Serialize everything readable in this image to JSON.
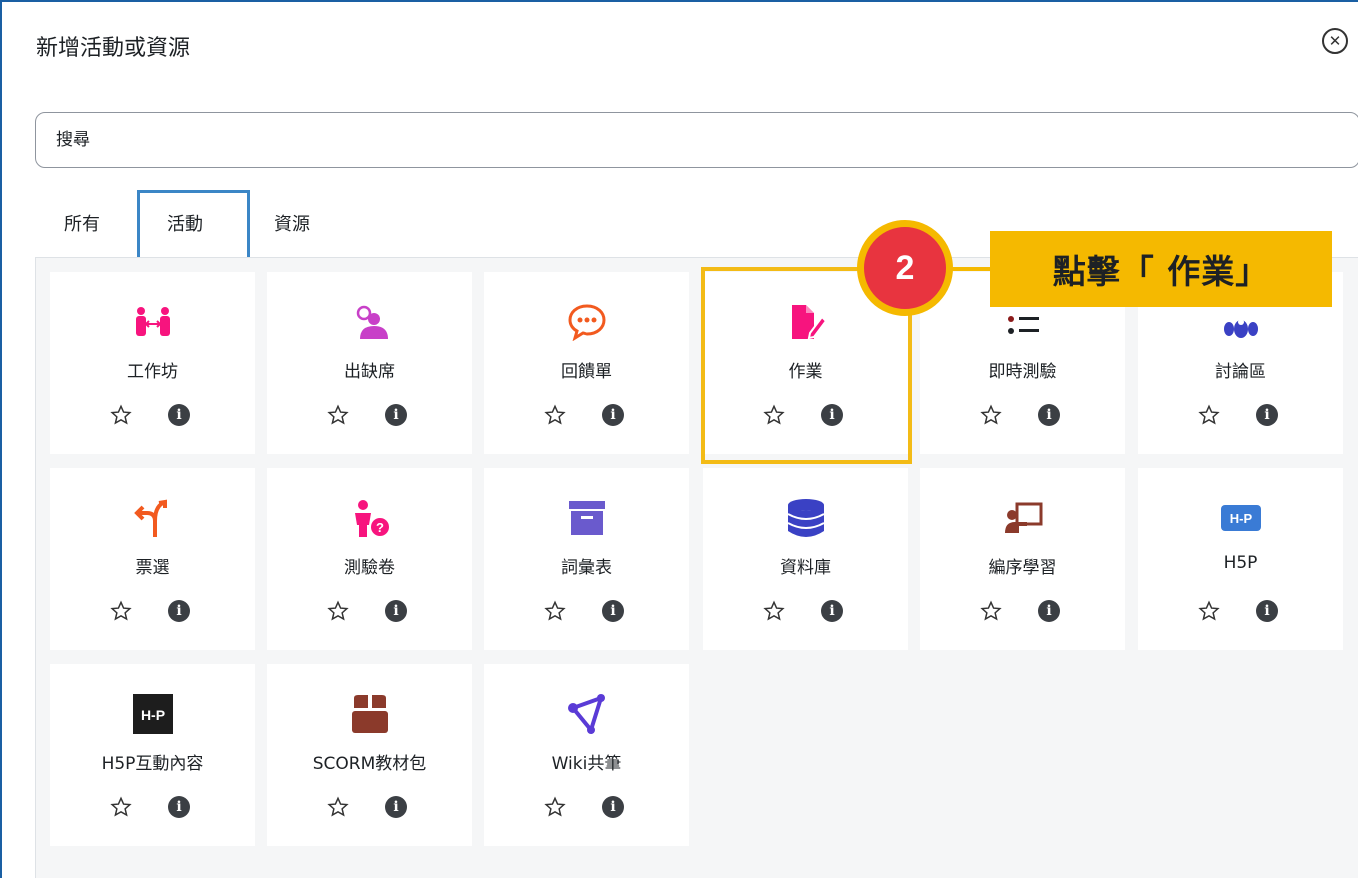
{
  "modal": {
    "title": "新增活動或資源",
    "close_icon": "close-circle-icon"
  },
  "search": {
    "placeholder": "搜尋"
  },
  "tabs": [
    {
      "label": "所有"
    },
    {
      "label": "活動",
      "active": true
    },
    {
      "label": "資源"
    }
  ],
  "items": [
    {
      "label": "工作坊",
      "icon": "workshop-icon",
      "color": "#f7147e"
    },
    {
      "label": "出缺席",
      "icon": "attendance-icon",
      "color": "#c840c8"
    },
    {
      "label": "回饋單",
      "icon": "feedback-icon",
      "color": "#f25a1f"
    },
    {
      "label": "作業",
      "icon": "assignment-icon",
      "color": "#f7147e"
    },
    {
      "label": "即時測驗",
      "icon": "quiz-list-icon",
      "color": "#1d2125"
    },
    {
      "label": "討論區",
      "icon": "forum-icon",
      "color": "#3a41c4"
    },
    {
      "label": "票選",
      "icon": "choice-icon",
      "color": "#f25a1f"
    },
    {
      "label": "測驗卷",
      "icon": "quiz-icon",
      "color": "#f7147e"
    },
    {
      "label": "詞彙表",
      "icon": "glossary-icon",
      "color": "#6a5acd"
    },
    {
      "label": "資料庫",
      "icon": "database-icon",
      "color": "#3a41c4"
    },
    {
      "label": "編序學習",
      "icon": "lesson-icon",
      "color": "#8b3a2b"
    },
    {
      "label": "H5P",
      "icon": "h5p-icon",
      "color": "#3a7bd5"
    },
    {
      "label": "H5P互動內容",
      "icon": "h5p-interactive-icon",
      "color": "#1d1d1d"
    },
    {
      "label": "SCORM教材包",
      "icon": "scorm-package-icon",
      "color": "#8b3a2b"
    },
    {
      "label": "Wiki共筆",
      "icon": "wiki-icon",
      "color": "#5a3bd6"
    }
  ],
  "annotation": {
    "step_number": "2",
    "callout_text": "點擊「 作業」",
    "accent_color": "#f5b900",
    "badge_color": "#e8343f"
  }
}
